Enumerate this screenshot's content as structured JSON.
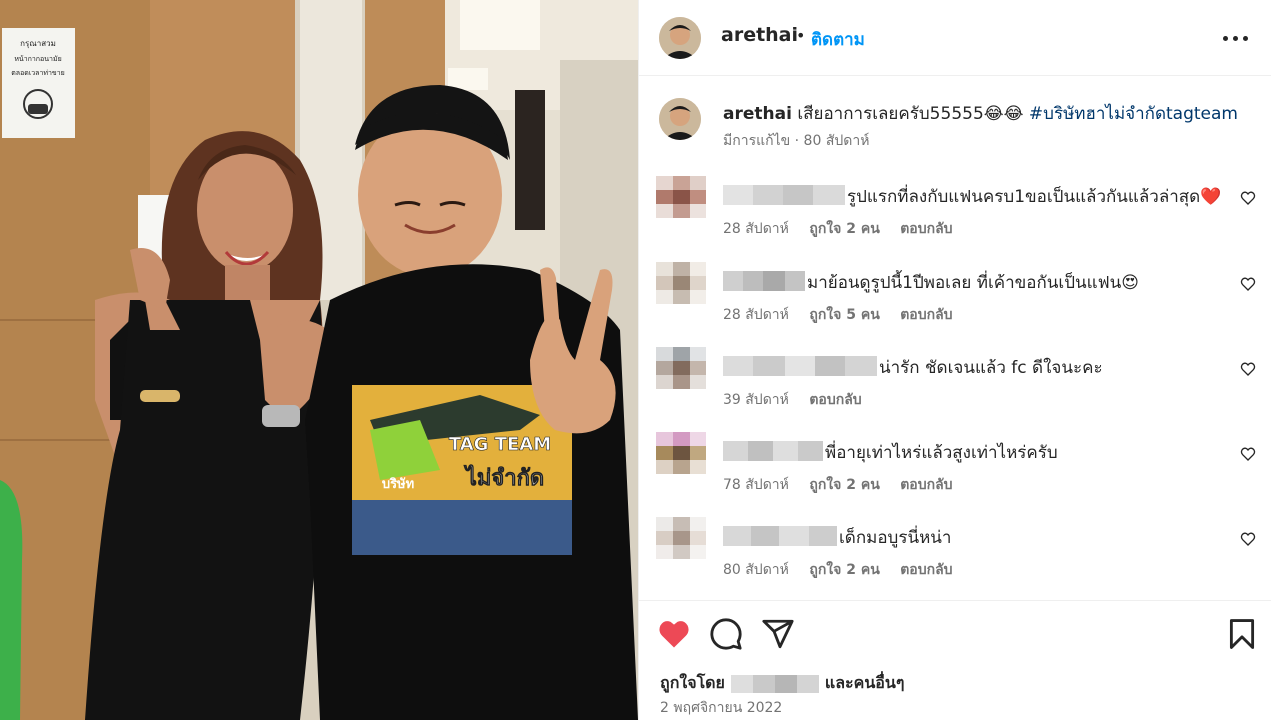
{
  "post": {
    "username": "arethai",
    "dot": "•",
    "follow_label": "ติดตาม",
    "more_icon": "more-horizontal-icon"
  },
  "photo": {
    "shirt_text_line1": "TAG TEAM",
    "shirt_text_line2": "ไม่จำกัด",
    "shirt_text_small": "บริษัท",
    "sign_line1": "กรุณาสวม",
    "sign_line2": "หน้ากากอนามัย",
    "sign_line3": "ตลอดเวลาท่าขาย"
  },
  "caption": {
    "username": "arethai",
    "text": "เสียอาการเลยครับ55555😂😂",
    "hashtag": "#บริษัทฮาไม่จำกัดtagteam",
    "meta": "มีการแก้ไข · 80 สัปดาห์"
  },
  "comments": [
    {
      "text": "รูปแรกที่ลงกับแฟนครบ1ขอเป็นแล้วกันแล้วล่าสุด❤️",
      "age": "28 สัปดาห์",
      "likes": "ถูกใจ 2 คน",
      "reply": "ตอบกลับ"
    },
    {
      "text": "มาย้อนดูรูปนี้1ปีพอเลย ที่เค้าขอกันเป็นแฟน😍",
      "age": "28 สัปดาห์",
      "likes": "ถูกใจ 5 คน",
      "reply": "ตอบกลับ"
    },
    {
      "text": "น่ารัก ชัดเจนแล้ว fc ดีใจนะคะ",
      "age": "39 สัปดาห์",
      "likes": "",
      "reply": "ตอบกลับ"
    },
    {
      "text": "พี่อายุเท่าไหร่แล้วสูงเท่าไหร่ครับ",
      "age": "78 สัปดาห์",
      "likes": "ถูกใจ 2 คน",
      "reply": "ตอบกลับ"
    },
    {
      "text": "เด็กมอบูรนี่หน่า",
      "age": "80 สัปดาห์",
      "likes": "ถูกใจ 2 คน",
      "reply": "ตอบกลับ"
    }
  ],
  "footer": {
    "liked_by_prefix": "ถูกใจโดย",
    "liked_by_suffix": "และคนอื่นๆ",
    "date": "2 พฤศจิกายน 2022"
  },
  "colors": {
    "like_red": "#ed4956",
    "follow_blue": "#0095f6",
    "hashtag": "#00376b",
    "secondary_text": "#737373"
  }
}
